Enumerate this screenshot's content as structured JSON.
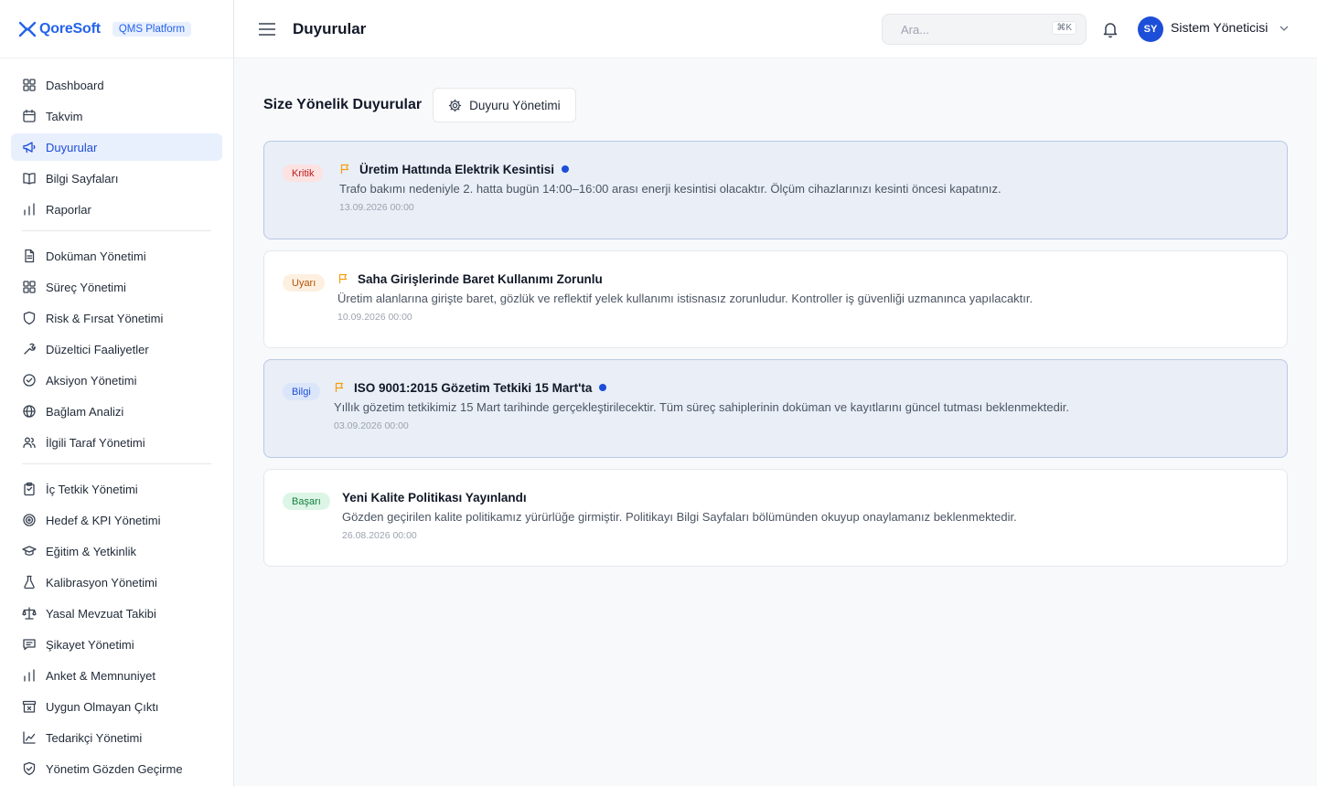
{
  "brand": {
    "name": "QoreSoft",
    "badge": "QMS Platform"
  },
  "header": {
    "title": "Duyurular",
    "search_placeholder": "Ara...",
    "search_shortcut": "⌘K",
    "user": {
      "initials": "SY",
      "name": "Sistem Yöneticisi"
    }
  },
  "sidebar": {
    "group1": [
      {
        "label": "Dashboard",
        "icon": "grid-icon"
      },
      {
        "label": "Takvim",
        "icon": "calendar-icon"
      },
      {
        "label": "Duyurular",
        "icon": "megaphone-icon",
        "active": true
      },
      {
        "label": "Bilgi Sayfaları",
        "icon": "book-icon"
      },
      {
        "label": "Raporlar",
        "icon": "bar-chart-icon"
      }
    ],
    "group2": [
      {
        "label": "Doküman Yönetimi",
        "icon": "file-icon"
      },
      {
        "label": "Süreç Yönetimi",
        "icon": "grid-icon"
      },
      {
        "label": "Risk & Fırsat Yönetimi",
        "icon": "shield-icon"
      },
      {
        "label": "Düzeltici Faaliyetler",
        "icon": "wrench-icon"
      },
      {
        "label": "Aksiyon Yönetimi",
        "icon": "check-circle-icon"
      },
      {
        "label": "Bağlam Analizi",
        "icon": "globe-icon"
      },
      {
        "label": "İlgili Taraf Yönetimi",
        "icon": "users-icon"
      }
    ],
    "group3": [
      {
        "label": "İç Tetkik Yönetimi",
        "icon": "clipboard-icon"
      },
      {
        "label": "Hedef & KPI Yönetimi",
        "icon": "target-icon"
      },
      {
        "label": "Eğitim & Yetkinlik",
        "icon": "graduation-cap-icon"
      },
      {
        "label": "Kalibrasyon Yönetimi",
        "icon": "flask-icon"
      },
      {
        "label": "Yasal Mevzuat Takibi",
        "icon": "scale-icon"
      },
      {
        "label": "Şikayet Yönetimi",
        "icon": "message-icon"
      },
      {
        "label": "Anket & Memnuniyet",
        "icon": "bar-chart-icon"
      },
      {
        "label": "Uygun Olmayan Çıktı",
        "icon": "archive-x-icon"
      },
      {
        "label": "Tedarikçi Yönetimi",
        "icon": "line-chart-icon"
      },
      {
        "label": "Yönetim Gözden Geçirme",
        "icon": "shield-check-icon"
      }
    ]
  },
  "main": {
    "section_title": "Size Yönelik Duyurular",
    "manage_button": "Duyuru Yönetimi",
    "announcements": [
      {
        "badge": "Kritik",
        "type": "kritik",
        "title": "Üretim Hattında Elektrik Kesintisi",
        "body": "Trafo bakımı nedeniyle 2. hatta bugün 14:00–16:00 arası enerji kesintisi olacaktır. Ölçüm cihazlarınızı kesinti öncesi kapatınız.",
        "date": "13.09.2026 00:00",
        "unread": true,
        "flagged": true
      },
      {
        "badge": "Uyarı",
        "type": "uyari",
        "title": "Saha Girişlerinde Baret Kullanımı Zorunlu",
        "body": "Üretim alanlarına girişte baret, gözlük ve reflektif yelek kullanımı istisnasız zorunludur. Kontroller iş güvenliği uzmanınca yapılacaktır.",
        "date": "10.09.2026 00:00",
        "unread": false,
        "flagged": true
      },
      {
        "badge": "Bilgi",
        "type": "bilgi",
        "title": "ISO 9001:2015 Gözetim Tetkiki 15 Mart'ta",
        "body": "Yıllık gözetim tetkikimiz 15 Mart tarihinde gerçekleştirilecektir. Tüm süreç sahiplerinin doküman ve kayıtlarını güncel tutması beklenmektedir.",
        "date": "03.09.2026 00:00",
        "unread": true,
        "flagged": true
      },
      {
        "badge": "Başarı",
        "type": "basari",
        "title": "Yeni Kalite Politikası Yayınlandı",
        "body": "Gözden geçirilen kalite politikamız yürürlüğe girmiştir. Politikayı Bilgi Sayfaları bölümünden okuyup onaylamanız beklenmektedir.",
        "date": "26.08.2026 00:00",
        "unread": false,
        "flagged": false
      }
    ]
  },
  "colors": {
    "accent": "#2563eb",
    "flag": "#f59e0b"
  }
}
